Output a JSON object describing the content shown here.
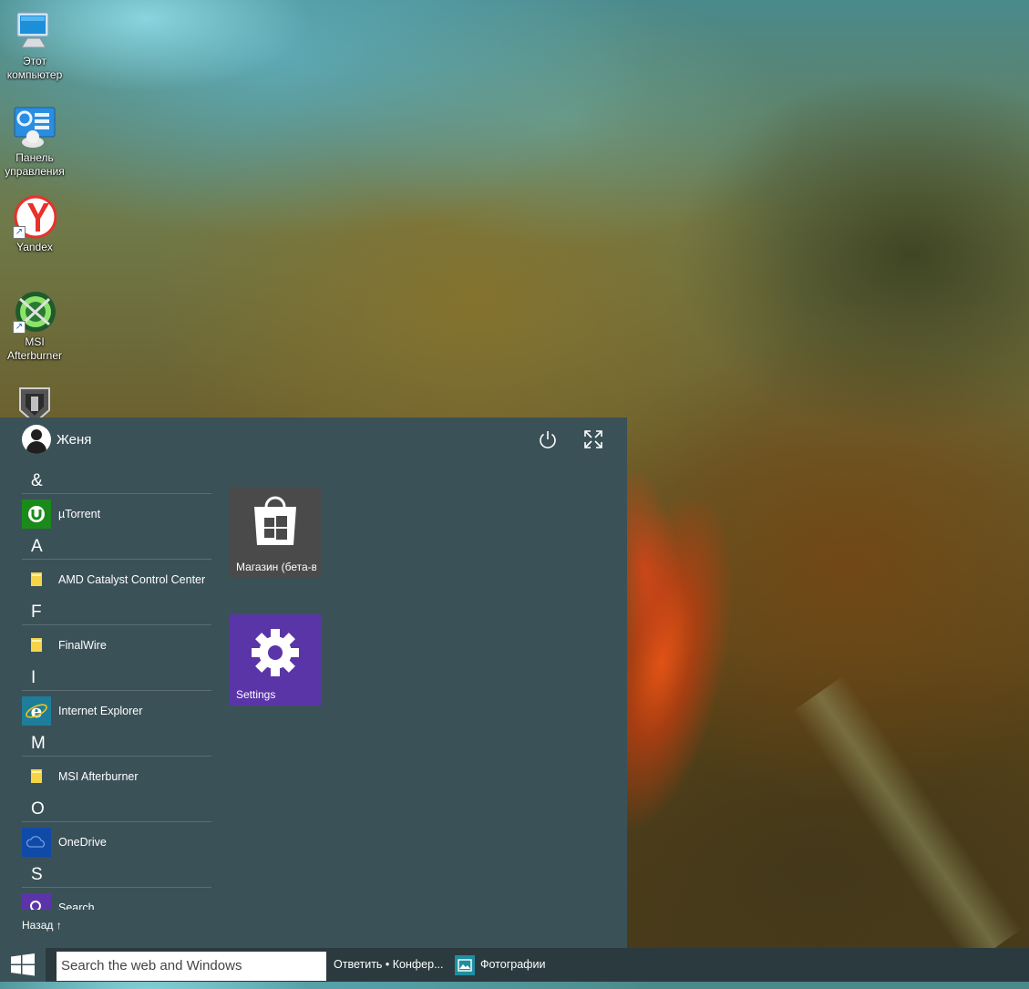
{
  "desktop": {
    "icons": [
      {
        "label": "Этот компьютер",
        "icon": "this-pc-icon"
      },
      {
        "label": "Панель управления",
        "icon": "control-panel-icon"
      },
      {
        "label": "Yandex",
        "icon": "yandex-browser-icon"
      },
      {
        "label": "MSI Afterburner",
        "icon": "msi-afterburner-icon"
      },
      {
        "label": "",
        "icon": "world-of-tanks-icon"
      }
    ]
  },
  "start_menu": {
    "user_name": "Женя",
    "power_icon": "power-icon",
    "expand_icon": "expand-icon",
    "app_list": [
      {
        "letter": "&",
        "apps": [
          {
            "name": "µTorrent",
            "icon": "utorrent-icon",
            "color": "#1a8a1a"
          }
        ]
      },
      {
        "letter": "A",
        "apps": [
          {
            "name": "AMD Catalyst Control Center",
            "icon": "folder-icon",
            "color": "#f5d547"
          }
        ]
      },
      {
        "letter": "F",
        "apps": [
          {
            "name": "FinalWire",
            "icon": "folder-icon",
            "color": "#f5d547"
          }
        ]
      },
      {
        "letter": "I",
        "apps": [
          {
            "name": "Internet Explorer",
            "icon": "internet-explorer-icon",
            "color": "#1e7d9a"
          }
        ]
      },
      {
        "letter": "M",
        "apps": [
          {
            "name": "MSI Afterburner",
            "icon": "folder-icon",
            "color": "#f5d547"
          }
        ]
      },
      {
        "letter": "O",
        "apps": [
          {
            "name": "OneDrive",
            "icon": "onedrive-icon",
            "color": "#0f4aa8"
          }
        ]
      },
      {
        "letter": "S",
        "apps": [
          {
            "name": "Search",
            "icon": "search-icon",
            "color": "#5b35a8"
          }
        ]
      }
    ],
    "back_label": "Назад ↑",
    "tiles": [
      {
        "label": "Магазин (бета-в",
        "icon": "store-icon",
        "color": "#4a4a4a"
      },
      {
        "label": "Settings",
        "icon": "gear-icon",
        "color": "#5a35a8"
      }
    ]
  },
  "taskbar": {
    "start_icon": "windows-logo-icon",
    "search_placeholder": "Search the web and Windows",
    "items": [
      {
        "label": "Ответить • Конфер...",
        "icon": "browser-window-icon"
      },
      {
        "label": "Фотографии",
        "icon": "photos-icon",
        "color": "#1e8fa0"
      }
    ]
  }
}
